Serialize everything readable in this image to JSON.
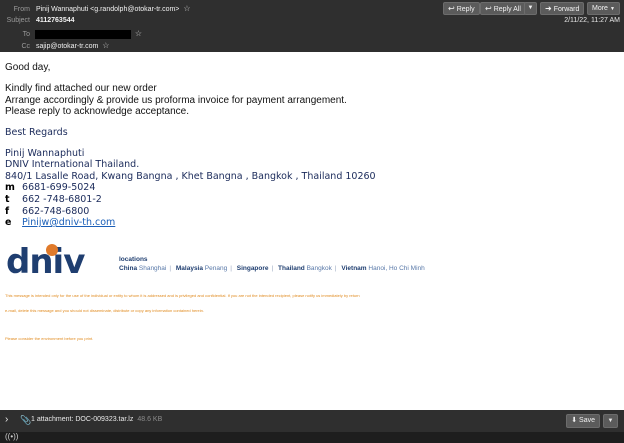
{
  "header": {
    "from_label": "From",
    "from_value": "Pinij Wannaphuti <g.randolph@otokar-tr.com>",
    "subject_label": "Subject",
    "subject_value": "4112763544",
    "to_label": "To",
    "cc_label": "Cc",
    "cc_value": "sajip@otokar-tr.com",
    "date": "2/11/22, 11:27 AM",
    "buttons": {
      "reply": "Reply",
      "reply_all": "Reply All",
      "forward": "Forward",
      "more": "More"
    }
  },
  "body": {
    "greeting": "Good day,",
    "line1": "Kindly find attached our new order",
    "line2": "Arrange accordingly & provide us proforma invoice for payment arrangement.",
    "line3": "Please reply to acknowledge acceptance.",
    "regards": "Best Regards",
    "sig_name": "Pinij Wannaphuti",
    "sig_company": "DNIV International Thailand.",
    "sig_address": "840/1 Lasalle Road, Kwang Bangna , Khet Bangna , Bangkok , Thailand 10260",
    "m_label": "m",
    "m_value": "6681-699-5024",
    "t_label": "t",
    "t_value": "662 -748-6801-2",
    "f_label": "f",
    "f_value": "662-748-6800",
    "e_label": "e",
    "e_value": "Pinijw@dniv-th.com",
    "logo_text": "dniv",
    "locations_title": "locations",
    "locations": [
      {
        "country": "China",
        "cities": "Shanghai"
      },
      {
        "country": "Malaysia",
        "cities": "Penang"
      },
      {
        "country": "Singapore",
        "cities": ""
      },
      {
        "country": "Thailand",
        "cities": "Bangkok"
      },
      {
        "country": "Vietnam",
        "cities": "Hanoi, Ho Chi Minh"
      }
    ],
    "disclaimer1": "This message is intended only for the use of the individual or entity to whom it is addressed and is privileged and confidential. If you are not the intended recipient, please notify us immediately by return",
    "disclaimer2": "e-mail, delete this message and you should not disseminate, distribute or copy any information contained herein.",
    "disclaimer3": "Please consider the environment before you print."
  },
  "footer": {
    "attachment_label": "1 attachment: DOC-009323.tar.lz",
    "attachment_size": "48.6 KB",
    "save_label": "Save"
  },
  "icons": [
    "star-icon",
    "reply-icon",
    "reply-all-icon",
    "forward-icon",
    "chevron-down-icon",
    "chevron-right-icon",
    "paperclip-icon",
    "save-icon",
    "antenna-icon"
  ],
  "colors": {
    "header_bg": "#2f2f2f",
    "link": "#1b5fb8",
    "disclaimer": "#e08a1e",
    "brand": "#1f3e70",
    "brand_accent": "#e07a2a"
  }
}
